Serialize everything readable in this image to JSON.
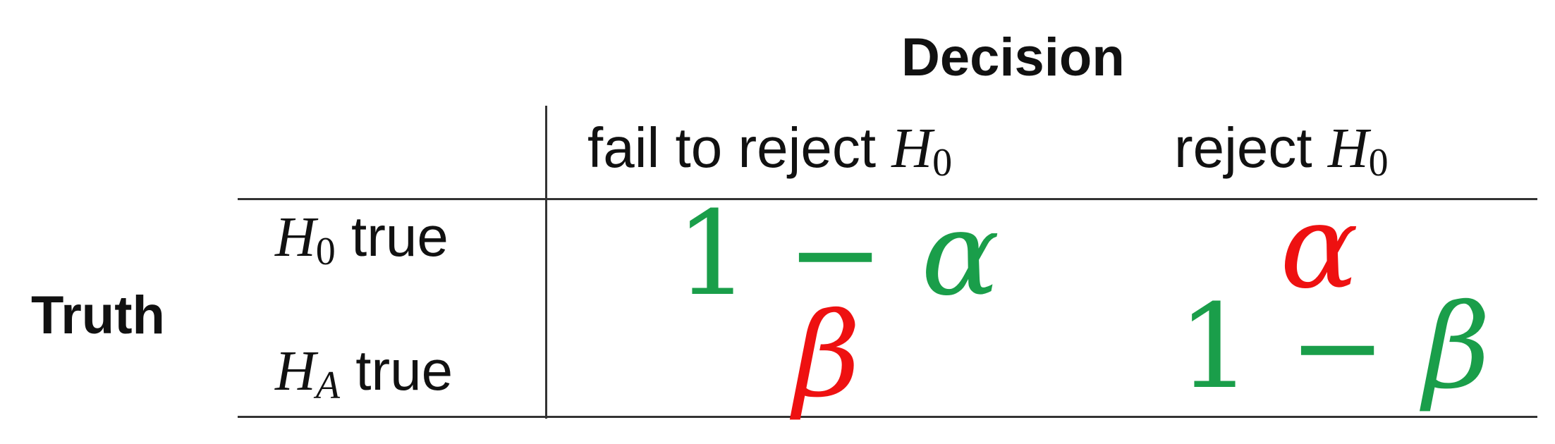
{
  "header": {
    "decision": "Decision",
    "truth": "Truth"
  },
  "columns": [
    {
      "text": "fail to reject",
      "math_symbol": "H",
      "math_sub": "0"
    },
    {
      "text": "reject",
      "math_symbol": "H",
      "math_sub": "0"
    }
  ],
  "rows": [
    {
      "math_symbol": "H",
      "math_sub": "0",
      "text": "true"
    },
    {
      "math_symbol": "H",
      "math_sub": "A",
      "text": "true"
    }
  ],
  "cells": {
    "h0_fail": {
      "number": "1",
      "operator": "−",
      "symbol": "α"
    },
    "h0_reject": {
      "symbol": "α"
    },
    "ha_fail": {
      "symbol": "β"
    },
    "ha_reject": {
      "number": "1",
      "operator": "−",
      "symbol": "β"
    }
  },
  "colors": {
    "correct": "#1a9e4a",
    "error": "#ee1111",
    "text": "#111111",
    "rule": "#333333"
  }
}
